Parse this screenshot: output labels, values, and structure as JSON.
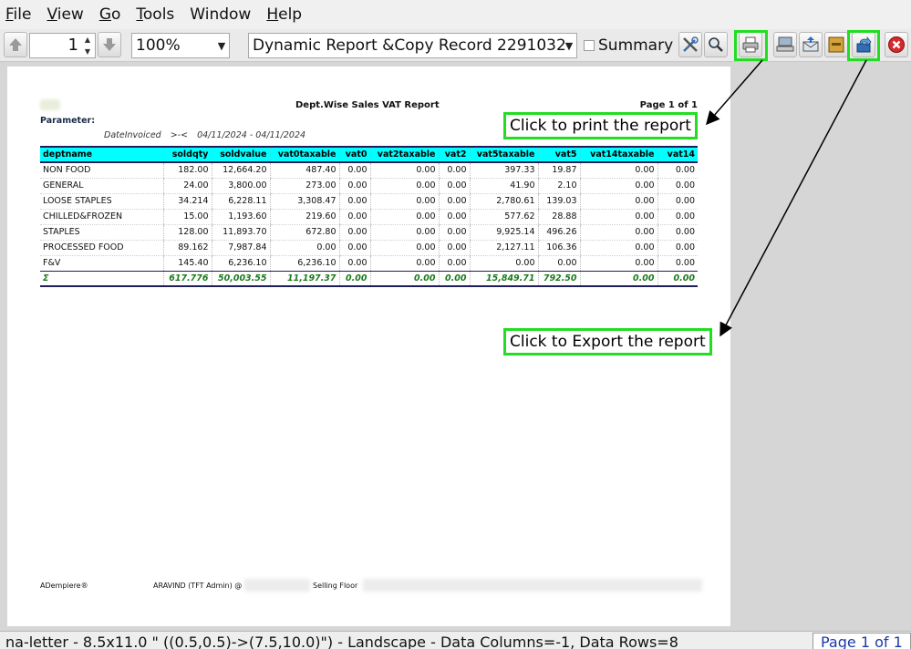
{
  "menu": {
    "file_u": "F",
    "file_rest": "ile",
    "view_u": "V",
    "view_rest": "iew",
    "go_u": "G",
    "go_rest": "o",
    "tools_u": "T",
    "tools_rest": "ools",
    "window": "Window",
    "help_u": "H",
    "help_rest": "elp"
  },
  "toolbar": {
    "page_number": "1",
    "zoom": "100%",
    "report_name": "Dynamic Report &Copy Record 2291032",
    "summary_label": "Summary"
  },
  "report": {
    "title": "Dept.Wise Sales VAT Report",
    "page": "Page 1 of 1",
    "parameter_label": "Parameter:",
    "param_name": "DateInvoiced",
    "param_op": ">-<",
    "param_value": "04/11/2024 - 04/11/2024",
    "columns": [
      "deptname",
      "soldqty",
      "soldvalue",
      "vat0taxable",
      "vat0",
      "vat2taxable",
      "vat2",
      "vat5taxable",
      "vat5",
      "vat14taxable",
      "vat14"
    ],
    "rows": [
      [
        "NON FOOD",
        "182.00",
        "12,664.20",
        "487.40",
        "0.00",
        "0.00",
        "0.00",
        "397.33",
        "19.87",
        "0.00",
        "0.00"
      ],
      [
        "GENERAL",
        "24.00",
        "3,800.00",
        "273.00",
        "0.00",
        "0.00",
        "0.00",
        "41.90",
        "2.10",
        "0.00",
        "0.00"
      ],
      [
        "LOOSE STAPLES",
        "34.214",
        "6,228.11",
        "3,308.47",
        "0.00",
        "0.00",
        "0.00",
        "2,780.61",
        "139.03",
        "0.00",
        "0.00"
      ],
      [
        "CHILLED&FROZEN",
        "15.00",
        "1,193.60",
        "219.60",
        "0.00",
        "0.00",
        "0.00",
        "577.62",
        "28.88",
        "0.00",
        "0.00"
      ],
      [
        "STAPLES",
        "128.00",
        "11,893.70",
        "672.80",
        "0.00",
        "0.00",
        "0.00",
        "9,925.14",
        "496.26",
        "0.00",
        "0.00"
      ],
      [
        "PROCESSED FOOD",
        "89.162",
        "7,987.84",
        "0.00",
        "0.00",
        "0.00",
        "0.00",
        "2,127.11",
        "106.36",
        "0.00",
        "0.00"
      ],
      [
        "F&V",
        "145.40",
        "6,236.10",
        "6,236.10",
        "0.00",
        "0.00",
        "0.00",
        "0.00",
        "0.00",
        "0.00",
        "0.00"
      ]
    ],
    "total": [
      "Σ",
      "617.776",
      "50,003.55",
      "11,197.37",
      "0.00",
      "0.00",
      "0.00",
      "15,849.71",
      "792.50",
      "0.00",
      "0.00"
    ],
    "footer_left": "ADempiere®",
    "footer_user": "ARAVIND (TFT Admin) @",
    "footer_mid": "Selling Floor"
  },
  "callouts": {
    "print": "Click to print the report",
    "export": "Click to Export the report"
  },
  "status": {
    "text": "na-letter - 8.5x11.0 \" ((0.5,0.5)->(7.5,10.0)\") - Landscape - Data Columns=-1, Data Rows=8",
    "page": "Page 1 of 1"
  },
  "colors": {
    "header_bg": "#00ffff",
    "highlight": "#22dd22",
    "total_text": "#1a7a1a",
    "status_page": "#1a3aa8"
  }
}
